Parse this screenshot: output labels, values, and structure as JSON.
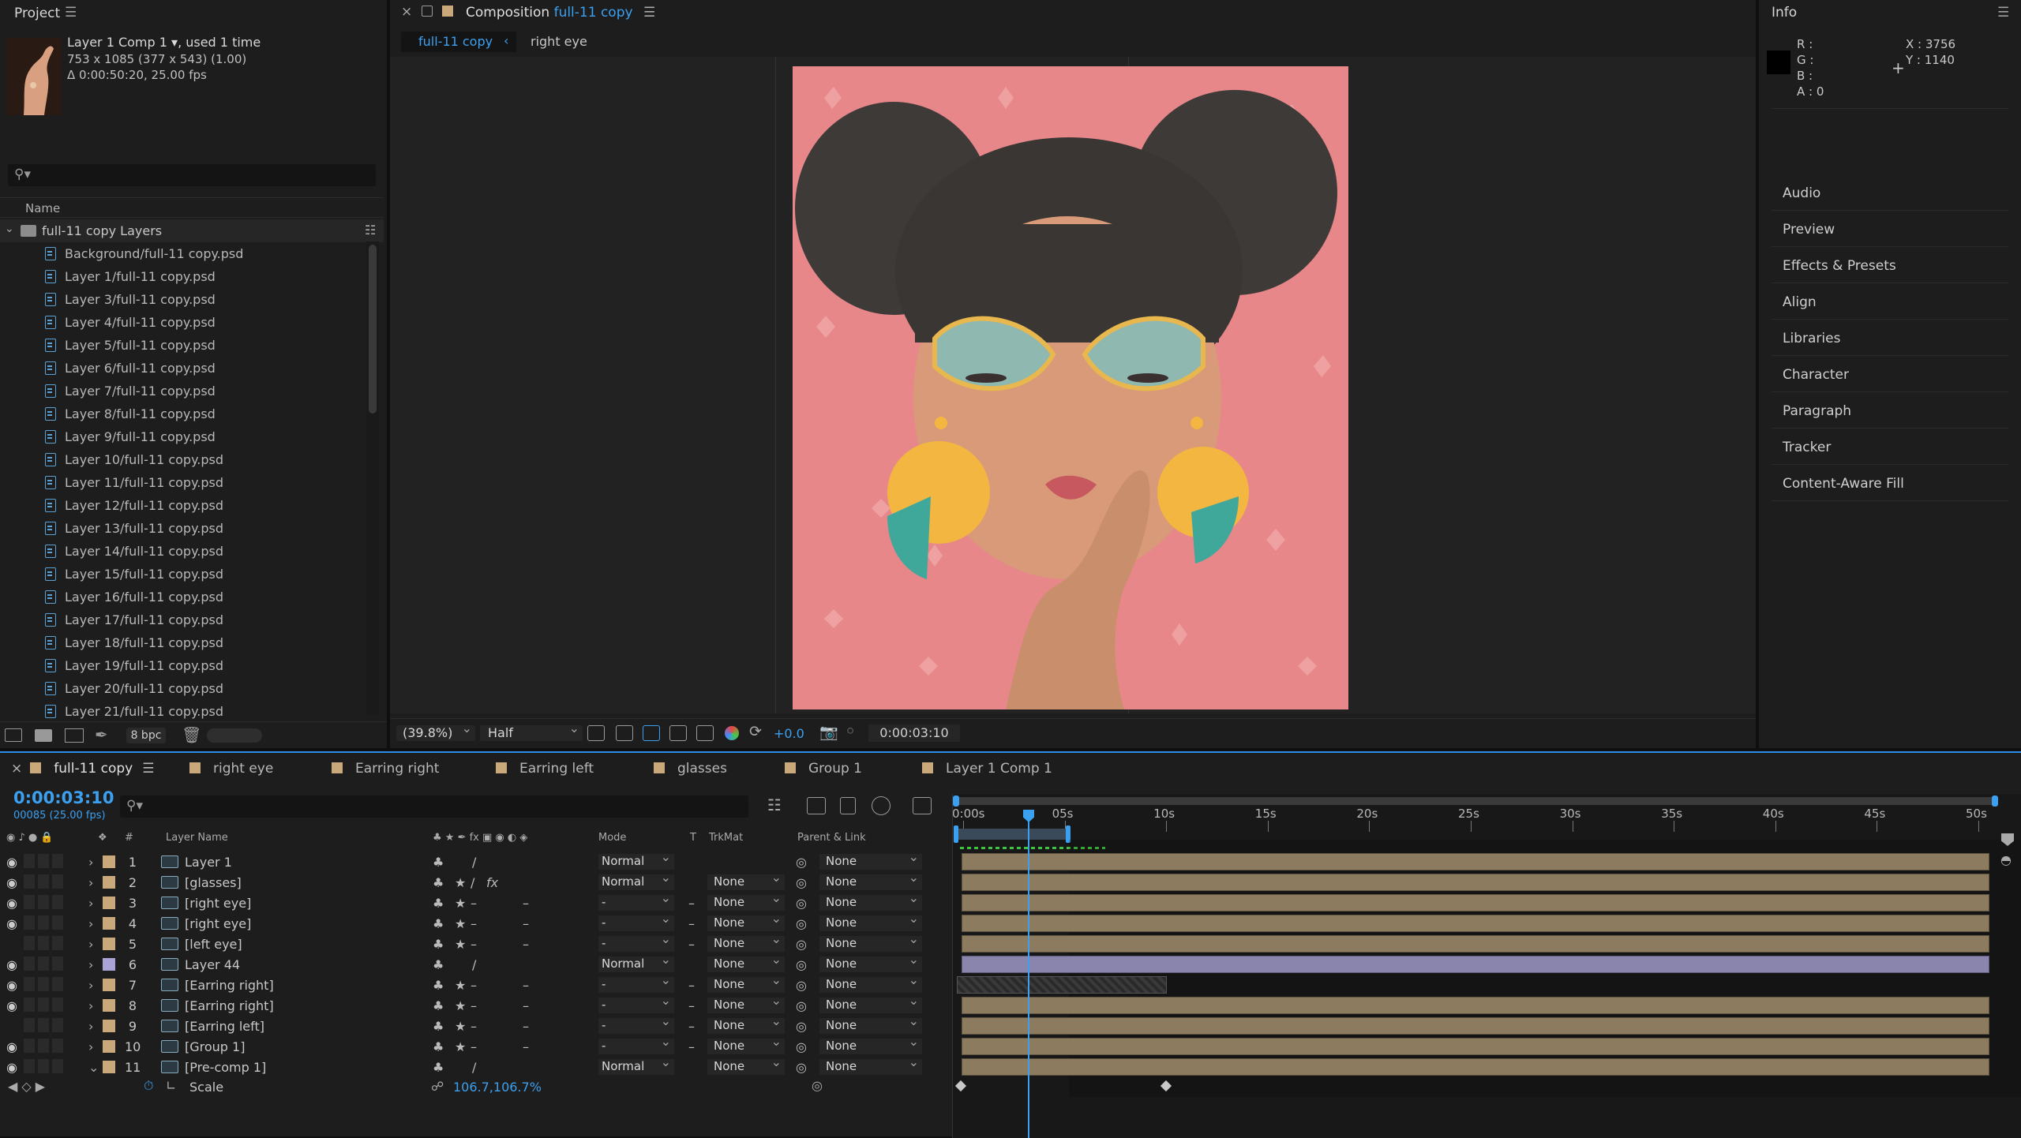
{
  "project": {
    "title": "Project",
    "item_name": "Layer 1 Comp 1",
    "item_used": ", used 1 time",
    "item_dims": "753 x 1085  (377 x 543) (1.00)",
    "item_duration": "Δ 0:00:50:20, 25.00 fps",
    "col_name": "Name",
    "folder": "full-11 copy Layers",
    "files": [
      "Background/full-11 copy.psd",
      "Layer 1/full-11 copy.psd",
      "Layer 3/full-11 copy.psd",
      "Layer 4/full-11 copy.psd",
      "Layer 5/full-11 copy.psd",
      "Layer 6/full-11 copy.psd",
      "Layer 7/full-11 copy.psd",
      "Layer 8/full-11 copy.psd",
      "Layer 9/full-11 copy.psd",
      "Layer 10/full-11 copy.psd",
      "Layer 11/full-11 copy.psd",
      "Layer 12/full-11 copy.psd",
      "Layer 13/full-11 copy.psd",
      "Layer 14/full-11 copy.psd",
      "Layer 15/full-11 copy.psd",
      "Layer 16/full-11 copy.psd",
      "Layer 17/full-11 copy.psd",
      "Layer 18/full-11 copy.psd",
      "Layer 19/full-11 copy.psd",
      "Layer 20/full-11 copy.psd",
      "Layer 21/full-11 copy.psd"
    ],
    "bpc": "8 bpc"
  },
  "viewer": {
    "panel_label": "Composition",
    "comp_name": "full-11 copy",
    "crumb_active": "full-11 copy",
    "crumb_next": "right eye",
    "zoom": "(39.8%)",
    "resolution": "Half",
    "exposure": "+0.0",
    "timecode": "0:00:03:10"
  },
  "info": {
    "title": "Info",
    "r": "R :",
    "g": "G :",
    "b": "B :",
    "a": "A :  0",
    "x": "X : 3756",
    "y": "Y : 1140"
  },
  "right_items": [
    "Audio",
    "Preview",
    "Effects & Presets",
    "Align",
    "Libraries",
    "Character",
    "Paragraph",
    "Tracker",
    "Content-Aware Fill"
  ],
  "timeline": {
    "tabs": [
      {
        "label": "full-11 copy",
        "color": "#c9a87a"
      },
      {
        "label": "right eye",
        "color": "#c9a87a"
      },
      {
        "label": "Earring right",
        "color": "#c9a87a"
      },
      {
        "label": "Earring left",
        "color": "#c9a87a"
      },
      {
        "label": "glasses",
        "color": "#c9a87a"
      },
      {
        "label": "Group 1",
        "color": "#c9a87a"
      },
      {
        "label": "Layer 1 Comp 1",
        "color": "#c9a87a"
      }
    ],
    "current_time": "0:00:03:10",
    "frame_info": "00085 (25.00 fps)",
    "col_layer_name": "Layer Name",
    "col_hash": "#",
    "col_mode": "Mode",
    "col_t": "T",
    "col_trkmat": "TrkMat",
    "col_parent": "Parent & Link",
    "ruler": [
      "0:00s",
      "05s",
      "10s",
      "15s",
      "20s",
      "25s",
      "30s",
      "35s",
      "40s",
      "45s",
      "50s"
    ],
    "layers": [
      {
        "num": "1",
        "name": "Layer 1",
        "mode": "Normal",
        "trk": "",
        "parent": "None",
        "color": "#c9a87a",
        "fx": false,
        "bar": "full"
      },
      {
        "num": "2",
        "name": "[glasses]",
        "mode": "Normal",
        "trk": "None",
        "parent": "None",
        "color": "#c9a87a",
        "fx": true,
        "bar": "full"
      },
      {
        "num": "3",
        "name": "[right eye]",
        "mode": "-",
        "trk": "None",
        "parent": "None",
        "color": "#c9a87a",
        "fx": false,
        "bar": "full"
      },
      {
        "num": "4",
        "name": "[right eye]",
        "mode": "-",
        "trk": "None",
        "parent": "None",
        "color": "#c9a87a",
        "fx": false,
        "bar": "full"
      },
      {
        "num": "5",
        "name": "[left eye]",
        "mode": "-",
        "trk": "None",
        "parent": "None",
        "color": "#c9a87a",
        "fx": false,
        "bar": "full"
      },
      {
        "num": "6",
        "name": "Layer 44",
        "mode": "Normal",
        "trk": "None",
        "parent": "None",
        "color": "#a9a3d6",
        "fx": false,
        "bar": "purple"
      },
      {
        "num": "7",
        "name": "[Earring right]",
        "mode": "-",
        "trk": "None",
        "parent": "None",
        "color": "#c9a87a",
        "fx": false,
        "bar": "short"
      },
      {
        "num": "8",
        "name": "[Earring right]",
        "mode": "-",
        "trk": "None",
        "parent": "None",
        "color": "#c9a87a",
        "fx": false,
        "bar": "full"
      },
      {
        "num": "9",
        "name": "[Earring left]",
        "mode": "-",
        "trk": "None",
        "parent": "None",
        "color": "#c9a87a",
        "fx": false,
        "bar": "full"
      },
      {
        "num": "10",
        "name": "[Group 1]",
        "mode": "-",
        "trk": "None",
        "parent": "None",
        "color": "#c9a87a",
        "fx": false,
        "bar": "full"
      },
      {
        "num": "11",
        "name": "[Pre-comp 1]",
        "mode": "Normal",
        "trk": "None",
        "parent": "None",
        "color": "#c9a87a",
        "fx": false,
        "bar": "full"
      }
    ],
    "scale_label": "Scale",
    "scale_value": "106.7,106.7%"
  }
}
